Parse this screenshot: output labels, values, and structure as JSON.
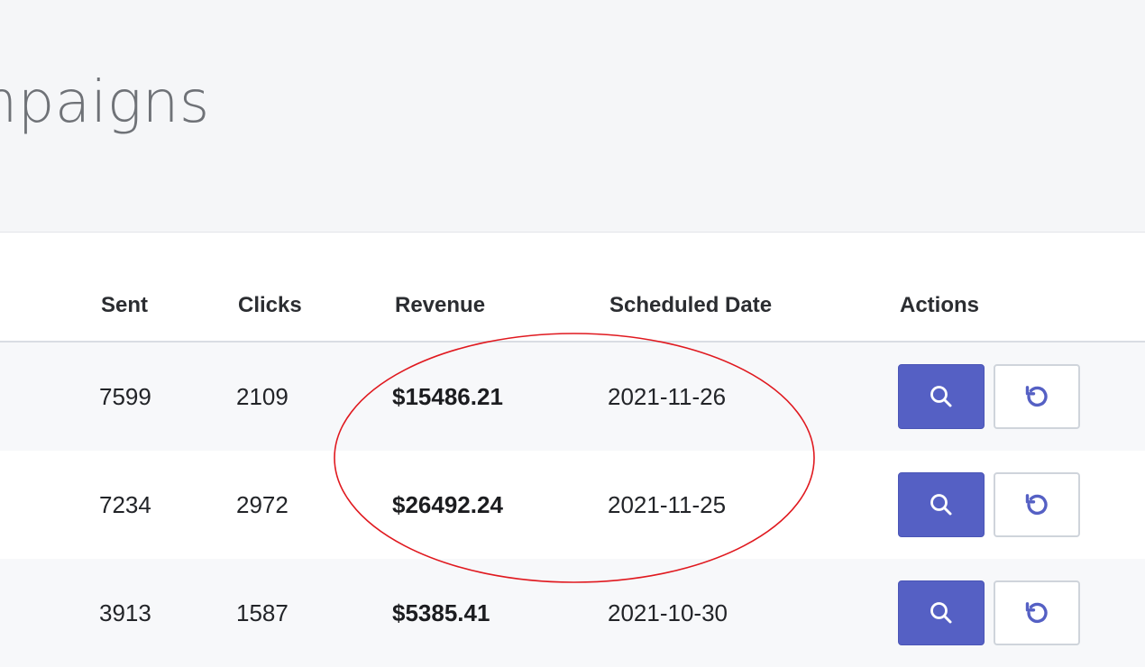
{
  "page": {
    "title": "Campaigns"
  },
  "table": {
    "columns": [
      "Sent",
      "Clicks",
      "Revenue",
      "Scheduled Date",
      "Actions"
    ],
    "rows": [
      {
        "sent": "7599",
        "clicks": "2109",
        "revenue": "$15486.21",
        "scheduled_date": "2021-11-26"
      },
      {
        "sent": "7234",
        "clicks": "2972",
        "revenue": "$26492.24",
        "scheduled_date": "2021-11-25"
      },
      {
        "sent": "3913",
        "clicks": "1587",
        "revenue": "$5385.41",
        "scheduled_date": "2021-10-30"
      }
    ]
  },
  "icons": {
    "view": "search-icon",
    "reset": "undo-icon"
  },
  "colors": {
    "primary": "#5560c4",
    "annotation": "#e0191f",
    "header_bg": "#f5f6f8",
    "row_stripe": "#f7f8fa"
  }
}
